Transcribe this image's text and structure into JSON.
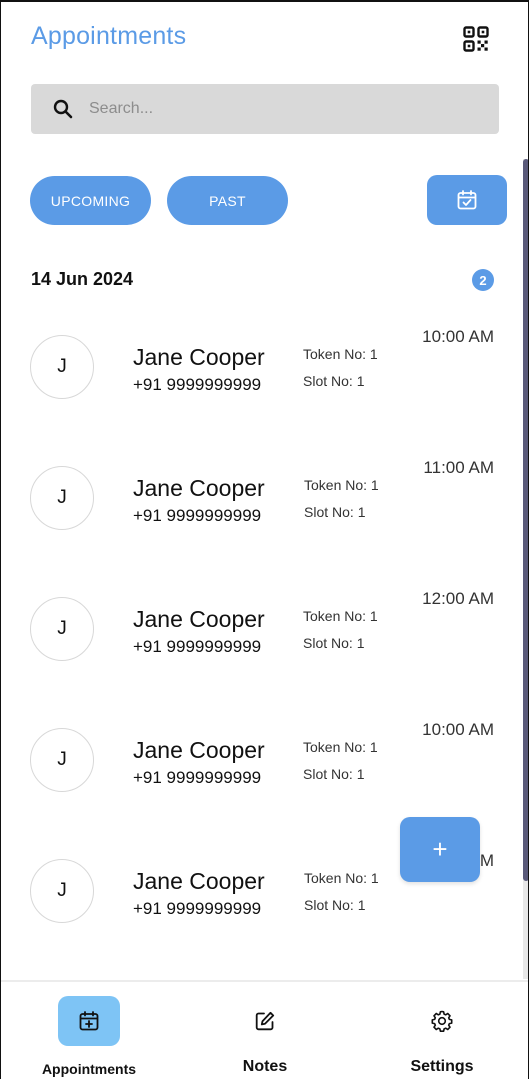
{
  "header": {
    "title": "Appointments",
    "qr_icon": "qr-code-icon"
  },
  "search": {
    "placeholder": "Search...",
    "value": "",
    "icon": "search-icon"
  },
  "filters": {
    "upcoming_label": "UPCOMING",
    "past_label": "PAST",
    "calendar_icon": "calendar-check-icon"
  },
  "section": {
    "date": "14 Jun 2024",
    "count": "2"
  },
  "appointments": [
    {
      "initial": "J",
      "name": "Jane Cooper",
      "phone": "+91 9999999999",
      "token": "Token No: 1",
      "slot": "Slot No: 1",
      "time": "10:00 AM"
    },
    {
      "initial": "J",
      "name": "Jane Cooper",
      "phone": "+91 9999999999",
      "token": "Token No: 1",
      "slot": "Slot No: 1",
      "time": "11:00 AM"
    },
    {
      "initial": "J",
      "name": "Jane Cooper",
      "phone": "+91 9999999999",
      "token": "Token No: 1",
      "slot": "Slot No: 1",
      "time": "12:00 AM"
    },
    {
      "initial": "J",
      "name": "Jane Cooper",
      "phone": "+91 9999999999",
      "token": "Token No: 1",
      "slot": "Slot No: 1",
      "time": "10:00 AM"
    },
    {
      "initial": "J",
      "name": "Jane Cooper",
      "phone": "+91 9999999999",
      "token": "Token No: 1",
      "slot": "Slot No: 1",
      "time": "M"
    }
  ],
  "fab": {
    "label": "+"
  },
  "bottom_nav": {
    "items": [
      {
        "label": "Appointments",
        "icon": "calendar-plus-icon",
        "active": true
      },
      {
        "label": "Notes",
        "icon": "edit-note-icon",
        "active": false
      },
      {
        "label": "Settings",
        "icon": "gear-icon",
        "active": false
      }
    ]
  },
  "colors": {
    "accent": "#5b9be6",
    "active_nav": "#7ec4f5",
    "search_bg": "#d9d9d9",
    "scroll_thumb": "#5a5a7a"
  }
}
